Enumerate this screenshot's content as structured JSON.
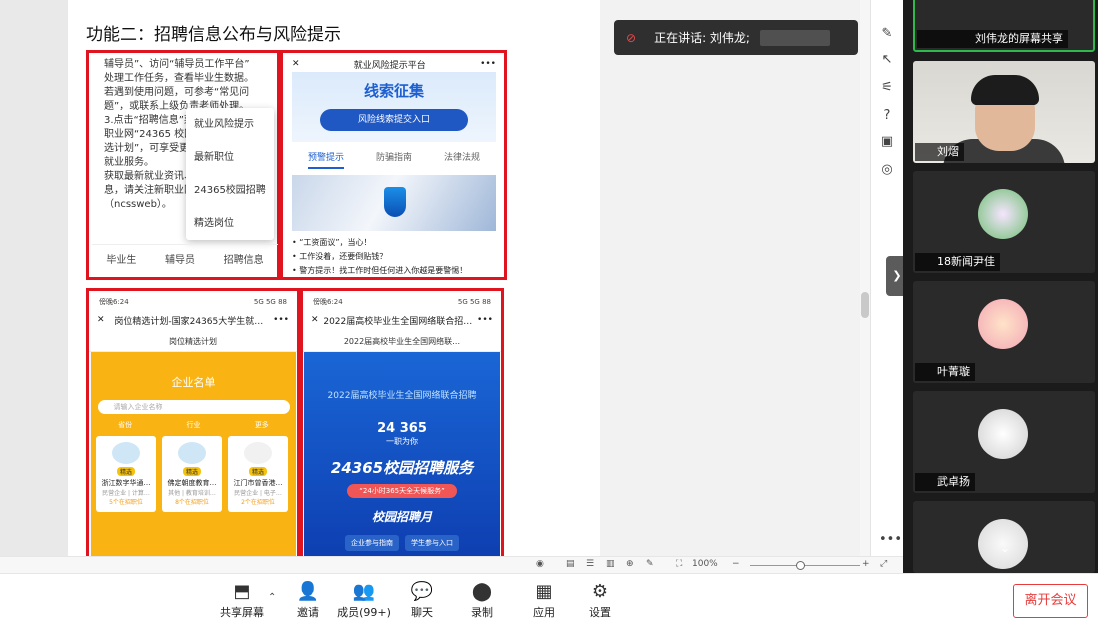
{
  "document": {
    "heading": "功能二：招聘信息公布与风险提示",
    "panel1": {
      "lines": [
        "辅导员”、访问“辅导员工作平台”",
        "处理工作任务，查看毕业生数据。",
        "若遇到使用问题，可参考“常见问",
        "题”，或联系上级负责老师处理。",
        "3.点击“招聘信息”菜单栏中的“新",
        "职业网“24365 校园招聘”",
        "选计划”，可享受更多",
        "就业服务。",
        "获取最新就业资讯、",
        "息，请关注新职业网",
        "（ncssweb）。"
      ],
      "menu": [
        "就业风险提示",
        "最新职位",
        "24365校园招聘",
        "精选岗位"
      ],
      "tabs": [
        "毕业生",
        "辅导员",
        "招聘信息"
      ]
    },
    "panel2": {
      "title": "就业风险提示平台",
      "banner_title": "线索征集",
      "banner_button": "风险线索提交入口",
      "tabs": [
        "预警提示",
        "防骗指南",
        "法律法规"
      ],
      "news": [
        "“工资面议”，当心！",
        "工作没着，还要倒贴钱？",
        "警方提示！找工作时但任何进入你越是要警惕！"
      ]
    },
    "panel3": {
      "status_time": "傍晚6:24",
      "status_right": "5G 5G 88",
      "title": "岗位精选计划-国家24365大学生就…",
      "subtitle": "岗位精选计划",
      "list_title": "企业名单",
      "search_placeholder": "请输入企业名称",
      "filters": [
        "省份",
        "行业",
        "更多"
      ],
      "cards": [
        {
          "badge": "精选",
          "name": "浙江数字华通…",
          "meta": "民营企业 | 计算…",
          "jobs": "5个在招职位"
        },
        {
          "badge": "精选",
          "name": "佛定朝度教育…",
          "meta": "其他 | 教育培训…",
          "jobs": "8个在招职位"
        },
        {
          "badge": "精选",
          "name": "江门市曾香港…",
          "meta": "民营企业 | 电子…",
          "jobs": "2个在招职位"
        }
      ]
    },
    "panel4": {
      "status_time": "傍晚6:24",
      "status_right": "5G 5G 88",
      "title": "2022届高校毕业生全国网络联合招…",
      "subtitle": "2022届高校毕业生全国网络联…",
      "banner_line1": "2022届高校毕业生全国网络联合招聘",
      "logo_num": "24 365",
      "logo_sub": "一职为你",
      "big_title": "24365校园招聘服务",
      "pill": "“24小时365天全天候服务”",
      "month": "校园招聘月",
      "buttons": [
        "企业参与指南",
        "学生参与入口"
      ]
    }
  },
  "speaking": {
    "label": "正在讲话: 刘伟龙;"
  },
  "statusbar": {
    "zoom": "100%"
  },
  "participants": [
    {
      "name": "刘伟龙的屏幕共享"
    },
    {
      "name": "刘熠"
    },
    {
      "name": "18新闻尹佳"
    },
    {
      "name": "叶菁璇"
    },
    {
      "name": "武卓扬"
    }
  ],
  "toolbar": {
    "share": "共享屏幕",
    "invite": "邀请",
    "members": "成员(99+)",
    "chat": "聊天",
    "record": "录制",
    "apps": "应用",
    "settings": "设置",
    "leave": "离开会议"
  }
}
